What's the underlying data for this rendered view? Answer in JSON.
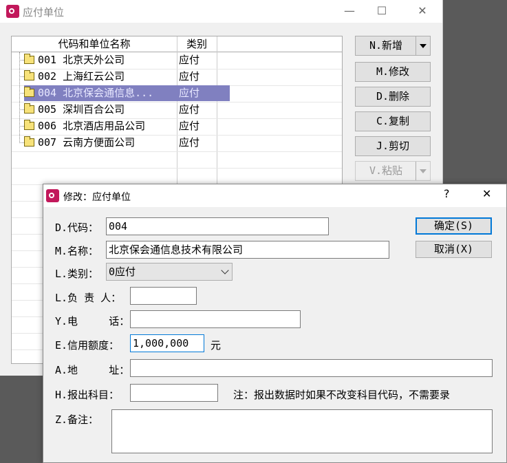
{
  "main_window": {
    "title": "应付单位",
    "minimize_glyph": "—",
    "maximize_glyph": "☐",
    "close_glyph": "✕"
  },
  "list": {
    "headers": [
      "代码和单位名称",
      "类别"
    ],
    "rows": [
      {
        "name": "001  北京天外公司",
        "category": "应付",
        "selected": false
      },
      {
        "name": "002  上海红云公司",
        "category": "应付",
        "selected": false
      },
      {
        "name": "004  北京保会通信息...",
        "category": "应付",
        "selected": true
      },
      {
        "name": "005  深圳百合公司",
        "category": "应付",
        "selected": false
      },
      {
        "name": "006  北京酒店用品公司",
        "category": "应付",
        "selected": false
      },
      {
        "name": "007  云南方便面公司",
        "category": "应付",
        "selected": false
      }
    ]
  },
  "side_buttons": {
    "add": "N.新增",
    "modify": "M.修改",
    "delete": "D.删除",
    "copy": "C.复制",
    "cut": "J.剪切",
    "paste": "V.粘贴"
  },
  "dialog": {
    "title": "修改：应付单位",
    "help_glyph": "?",
    "close_glyph": "✕",
    "code_label": "D.代码：",
    "code_value": "004",
    "name_label": "M.名称：",
    "name_value": "北京保会通信息技术有限公司",
    "category_label": "L.类别：",
    "category_value": "0应付",
    "manager_label": "L.负 责 人：",
    "manager_value": "",
    "phone_label": "Y.电     话：",
    "phone_value": "",
    "credit_label": "E.信用额度：",
    "credit_value": "1,000,000",
    "credit_unit": "元",
    "address_label": "A.地     址：",
    "address_value": "",
    "subject_label": "H.报出科目：",
    "subject_value": "",
    "subject_note": "注：报出数据时如果不改变科目代码，不需要录",
    "remark_label": "Z.备注：",
    "remark_value": "",
    "ok_button": "确定(S)",
    "cancel_button": "取消(X)"
  },
  "colors": {
    "selection": "#8080c0",
    "app_icon": "#c2185b",
    "focus_border": "#0078d7"
  }
}
